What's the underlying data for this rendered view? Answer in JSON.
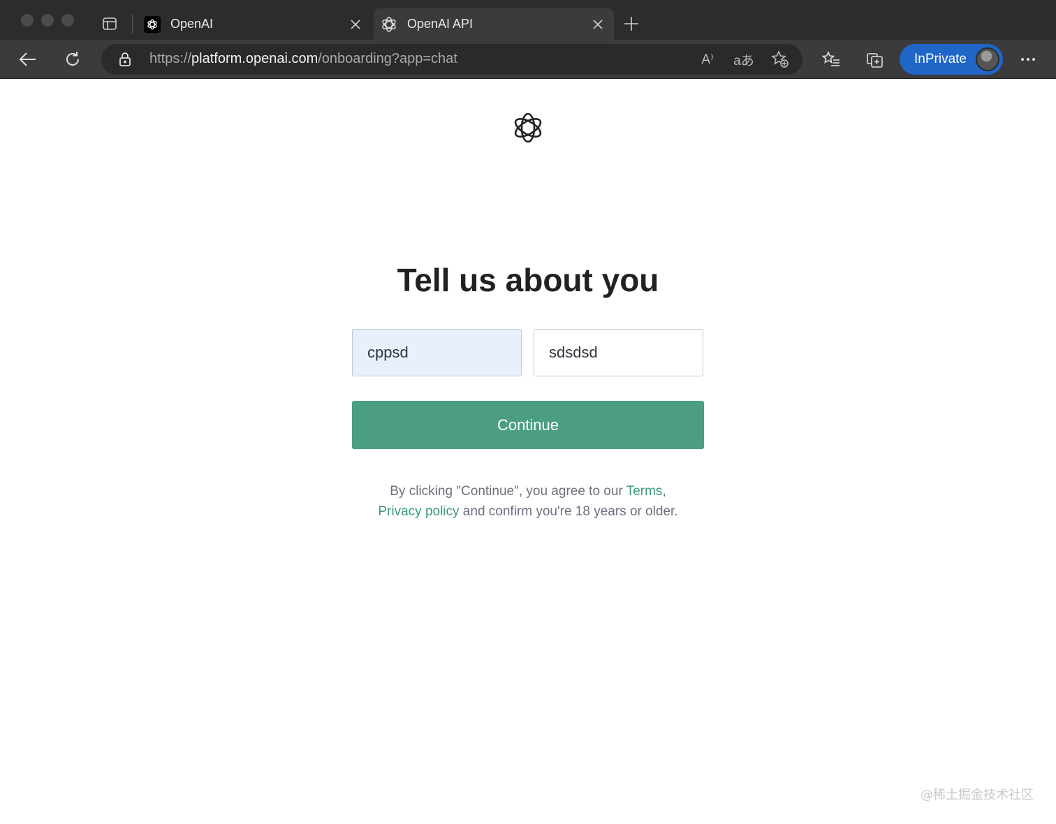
{
  "browser": {
    "tabs": [
      {
        "title": "OpenAI",
        "active": false
      },
      {
        "title": "OpenAI API",
        "active": true
      }
    ],
    "address": {
      "scheme": "https://",
      "host": "platform.openai.com",
      "path": "/onboarding?app=chat"
    },
    "inprivate_label": "InPrivate",
    "read_aloud_icon": "A⁾",
    "translate_icon": "aあ"
  },
  "page": {
    "title": "Tell us about you",
    "first_name_value": "cppsd",
    "last_name_value": "sdsdsd",
    "continue_label": "Continue",
    "legal": {
      "prefix": "By clicking \"Continue\", you agree to our ",
      "terms": "Terms",
      "comma": ",",
      "privacy": "Privacy policy",
      "suffix": " and confirm you're 18 years or older."
    }
  },
  "watermark": "@稀土掘金技术社区",
  "colors": {
    "accent_green": "#4b9f80",
    "link_green": "#3a9a78",
    "inprivate_blue": "#1f66c7",
    "autofill_blue": "#e8f0fe"
  }
}
